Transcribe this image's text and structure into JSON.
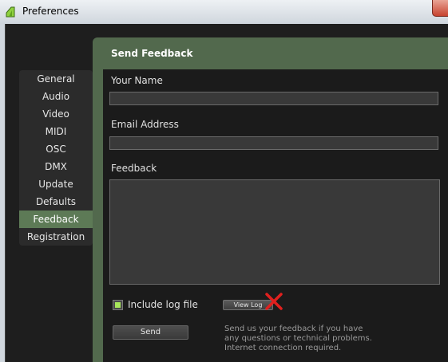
{
  "window": {
    "title": "Preferences",
    "icon": "app-logo-icon",
    "close_icon": "close-icon"
  },
  "sidebar": {
    "items": [
      {
        "label": "General",
        "active": false
      },
      {
        "label": "Audio",
        "active": false
      },
      {
        "label": "Video",
        "active": false
      },
      {
        "label": "MIDI",
        "active": false
      },
      {
        "label": "OSC",
        "active": false
      },
      {
        "label": "DMX",
        "active": false
      },
      {
        "label": "Update",
        "active": false
      },
      {
        "label": "Defaults",
        "active": false
      },
      {
        "label": "Feedback",
        "active": true
      },
      {
        "label": "Registration",
        "active": false
      }
    ]
  },
  "panel": {
    "title": "Send Feedback",
    "name_label": "Your Name",
    "name_value": "",
    "email_label": "Email Address",
    "email_value": "",
    "feedback_label": "Feedback",
    "feedback_value": "",
    "include_log_label": "Include log file",
    "include_log_checked": true,
    "view_log_label": "View Log",
    "send_label": "Send",
    "help_lines": [
      "Send us your feedback if you have",
      "any questions or technical problems.",
      "Internet connection required."
    ]
  },
  "colors": {
    "accent": "#5d7a56",
    "panel_header": "#52694d",
    "checkbox_on": "#a7e65a",
    "annotation_x": "#e0201e"
  }
}
